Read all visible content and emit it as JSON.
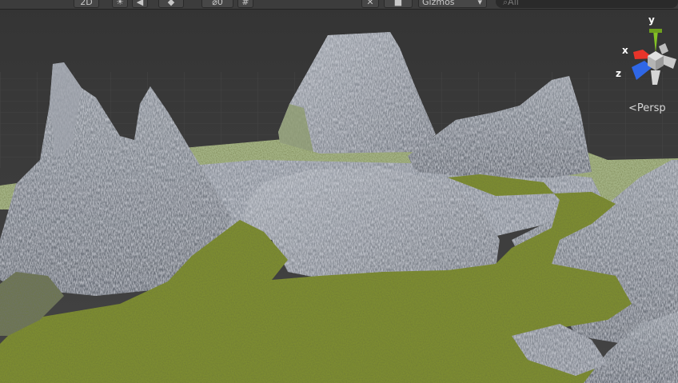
{
  "toolbar": {
    "mode_2d": "2D",
    "hidden_count": "0",
    "gizmos_label": "Gizmos",
    "search_placeholder": "All"
  },
  "orientation_gizmo": {
    "x_label": "x",
    "y_label": "y",
    "z_label": "z",
    "projection_label": "Persp",
    "colors": {
      "x": "#e8342a",
      "y": "#84c225",
      "z": "#2f67e6"
    }
  },
  "icons": [
    "light-icon",
    "audio-icon",
    "effects-icon",
    "hidden-objects-icon",
    "grid-icon",
    "tools-icon",
    "camera-icon",
    "search-icon"
  ]
}
